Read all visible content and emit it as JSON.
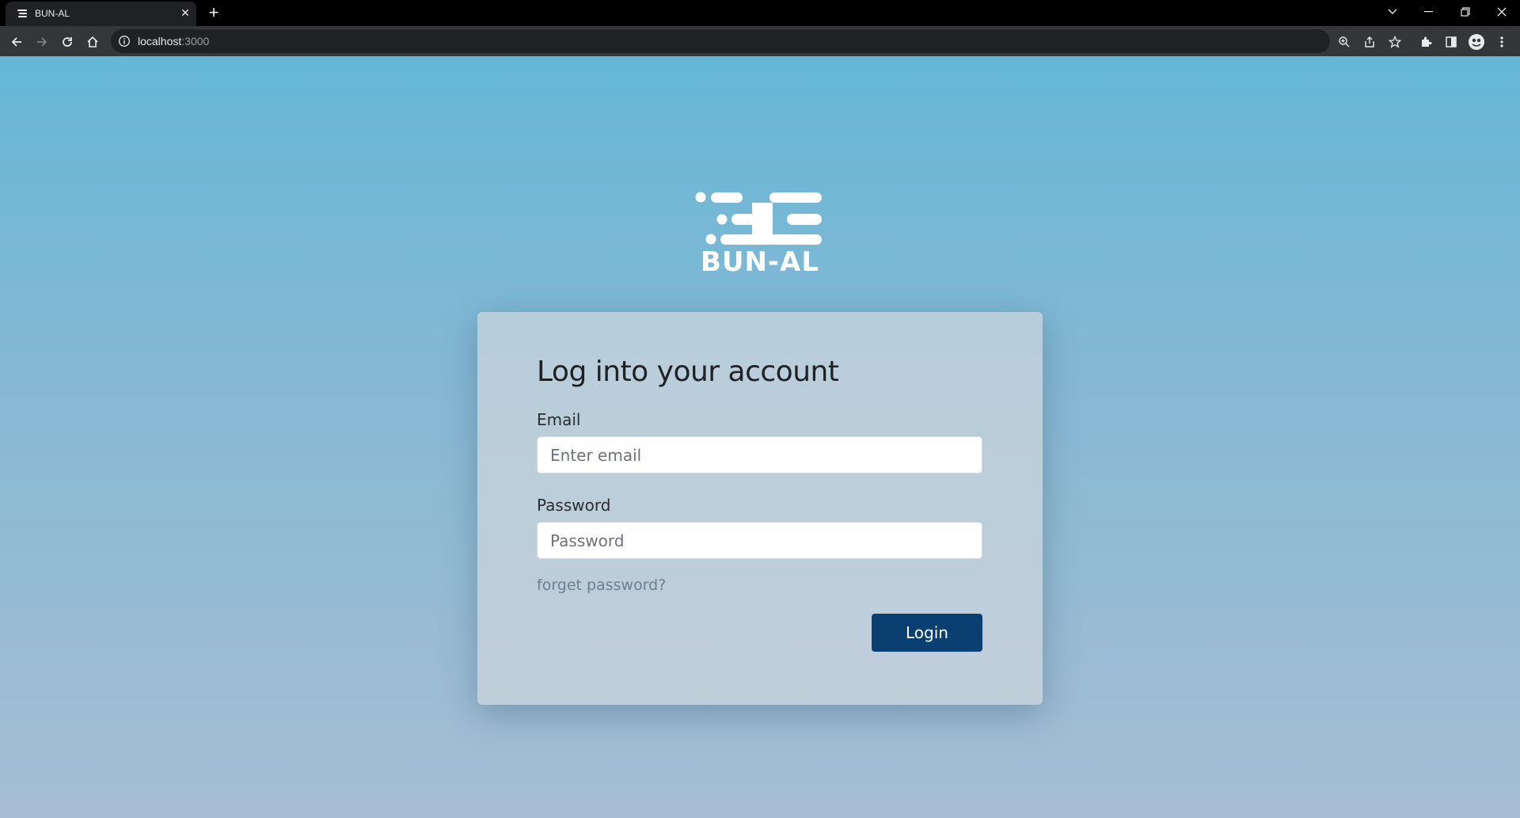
{
  "browser": {
    "tab_title": "BUN-AL",
    "tab_close_symbol": "✕",
    "new_tab_symbol": "+",
    "url_host": "localhost",
    "url_port": ":3000",
    "icons": [
      "back-icon",
      "forward-icon",
      "reload-icon",
      "home-icon",
      "info-icon",
      "zoom-icon",
      "share-icon",
      "star-icon",
      "extensions-icon",
      "side-panel-icon",
      "profile-icon",
      "menu-icon"
    ]
  },
  "brand": {
    "name": "BUN-AL",
    "logo_color": "#ffffff"
  },
  "login_form": {
    "title": "Log into your account",
    "email_label": "Email",
    "email_placeholder": "Enter email",
    "email_value": "",
    "password_label": "Password",
    "password_placeholder": "Password",
    "password_value": "",
    "forgot_link": "forget password?",
    "submit_label": "Login"
  },
  "colors": {
    "accent": "#0a3f72",
    "background_top": "#65b7d7",
    "background_bottom": "#a6bed3"
  }
}
